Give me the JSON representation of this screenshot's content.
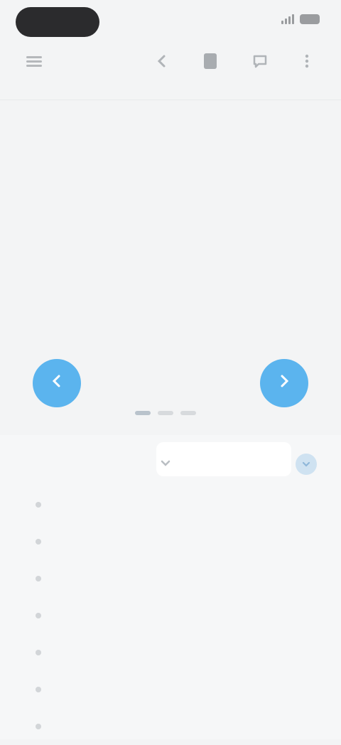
{
  "status_bar": {
    "time": "",
    "icons": [
      "signal-icon",
      "battery-icon"
    ]
  },
  "toolbar": {
    "icons": [
      "menu-icon",
      "back-icon",
      "book-icon",
      "chat-icon",
      "more-icon"
    ]
  },
  "description": {
    "overline": "",
    "text": "",
    "link_text": ""
  },
  "audio": {
    "prev_icon": "previous-icon",
    "next_icon": "next-icon",
    "accent_color": "#5bb4ee",
    "pages": 3,
    "current_page": 1
  },
  "ingredients": {
    "header": "",
    "items": [
      {
        "qty": "",
        "name": ""
      },
      {
        "qty": "",
        "name": ""
      },
      {
        "qty": "",
        "name": ""
      },
      {
        "qty": "",
        "name": ""
      },
      {
        "qty": "",
        "name": ""
      },
      {
        "qty": "",
        "name": ""
      },
      {
        "qty": "",
        "name": ""
      }
    ]
  },
  "colors": {
    "background": "#f3f4f5",
    "accent": "#5bb4ee",
    "link": "#7fb8e8"
  }
}
